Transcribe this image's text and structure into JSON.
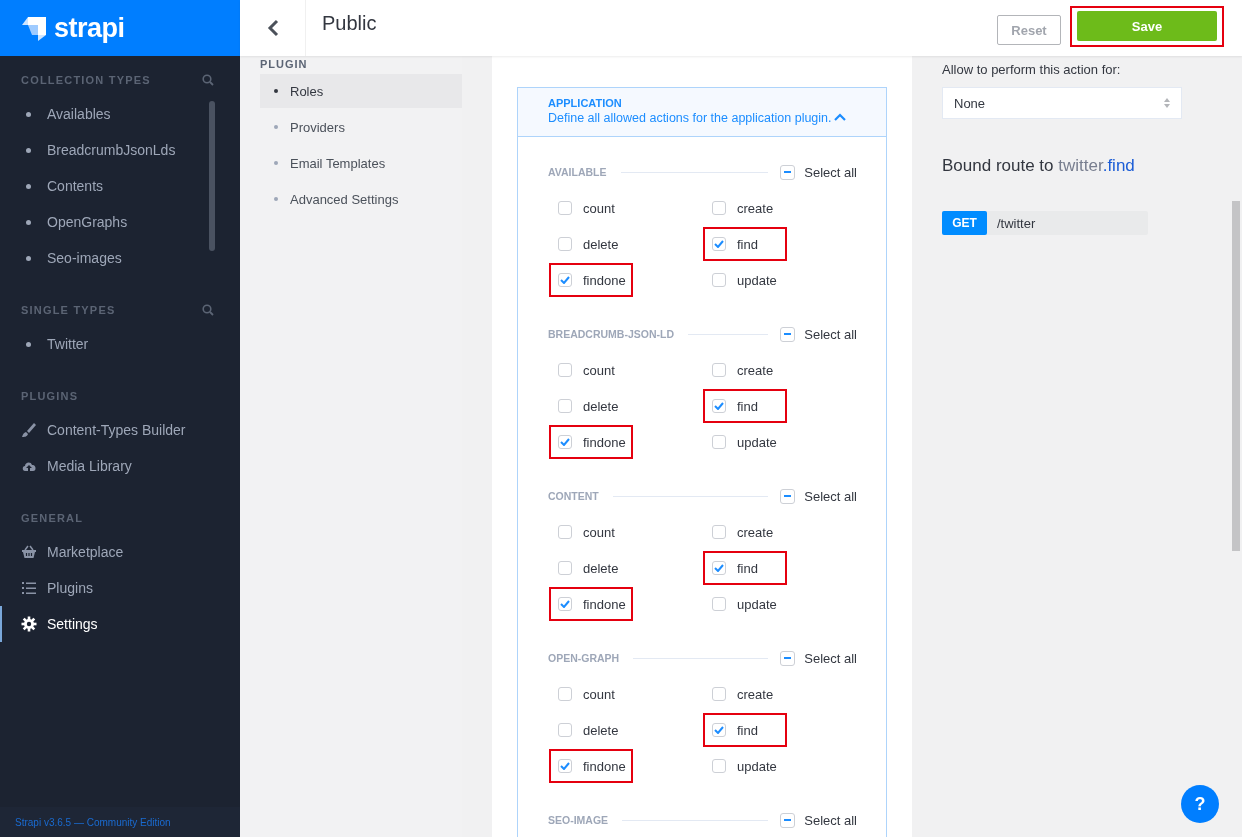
{
  "sidebar": {
    "logo": "strapi",
    "sections": [
      {
        "title": "COLLECTION TYPES",
        "searchable": true,
        "scrollable": true,
        "items": [
          {
            "label": "Availables",
            "kind": "bullet",
            "selected": false
          },
          {
            "label": "BreadcrumbJsonLds",
            "kind": "bullet",
            "selected": false
          },
          {
            "label": "Contents",
            "kind": "bullet",
            "selected": false
          },
          {
            "label": "OpenGraphs",
            "kind": "bullet",
            "selected": false
          },
          {
            "label": "Seo-images",
            "kind": "bullet",
            "selected": false
          }
        ]
      },
      {
        "title": "SINGLE TYPES",
        "searchable": true,
        "scrollable": false,
        "items": [
          {
            "label": "Twitter",
            "kind": "bullet",
            "selected": false
          }
        ]
      },
      {
        "title": "PLUGINS",
        "searchable": false,
        "scrollable": false,
        "items": [
          {
            "label": "Content-Types Builder",
            "kind": "brush",
            "selected": false
          },
          {
            "label": "Media Library",
            "kind": "cloud",
            "selected": false
          }
        ]
      },
      {
        "title": "GENERAL",
        "searchable": false,
        "scrollable": false,
        "items": [
          {
            "label": "Marketplace",
            "kind": "basket",
            "selected": false
          },
          {
            "label": "Plugins",
            "kind": "list",
            "selected": false
          },
          {
            "label": "Settings",
            "kind": "gear",
            "selected": true
          }
        ]
      }
    ],
    "footer": "Strapi v3.6.5 — Community Edition"
  },
  "header": {
    "title": "Public",
    "buttons": [
      {
        "label": "Reset",
        "kind": "secondary",
        "highlighted": false
      },
      {
        "label": "Save",
        "kind": "primary",
        "highlighted": true
      }
    ]
  },
  "subnav": {
    "title": "PLUGIN",
    "items": [
      {
        "label": "Roles",
        "selected": true
      },
      {
        "label": "Providers",
        "selected": false
      },
      {
        "label": "Email Templates",
        "selected": false
      },
      {
        "label": "Advanced Settings",
        "selected": false
      }
    ]
  },
  "plugin": {
    "name": "APPLICATION",
    "description": "Define all allowed actions for the application plugin.",
    "expanded": true,
    "groups": [
      {
        "name": "AVAILABLE",
        "select_all": {
          "label": "Select all",
          "indeterminate": true
        },
        "options": [
          {
            "label": "count",
            "checked": false,
            "highlighted": false
          },
          {
            "label": "create",
            "checked": false,
            "highlighted": false
          },
          {
            "label": "delete",
            "checked": false,
            "highlighted": false
          },
          {
            "label": "find",
            "checked": true,
            "highlighted": true
          },
          {
            "label": "findone",
            "checked": true,
            "highlighted": true
          },
          {
            "label": "update",
            "checked": false,
            "highlighted": false
          }
        ]
      },
      {
        "name": "BREADCRUMB-JSON-LD",
        "select_all": {
          "label": "Select all",
          "indeterminate": true
        },
        "options": [
          {
            "label": "count",
            "checked": false,
            "highlighted": false
          },
          {
            "label": "create",
            "checked": false,
            "highlighted": false
          },
          {
            "label": "delete",
            "checked": false,
            "highlighted": false
          },
          {
            "label": "find",
            "checked": true,
            "highlighted": true
          },
          {
            "label": "findone",
            "checked": true,
            "highlighted": true
          },
          {
            "label": "update",
            "checked": false,
            "highlighted": false
          }
        ]
      },
      {
        "name": "CONTENT",
        "select_all": {
          "label": "Select all",
          "indeterminate": true
        },
        "options": [
          {
            "label": "count",
            "checked": false,
            "highlighted": false
          },
          {
            "label": "create",
            "checked": false,
            "highlighted": false
          },
          {
            "label": "delete",
            "checked": false,
            "highlighted": false
          },
          {
            "label": "find",
            "checked": true,
            "highlighted": true
          },
          {
            "label": "findone",
            "checked": true,
            "highlighted": true
          },
          {
            "label": "update",
            "checked": false,
            "highlighted": false
          }
        ]
      },
      {
        "name": "OPEN-GRAPH",
        "select_all": {
          "label": "Select all",
          "indeterminate": true
        },
        "options": [
          {
            "label": "count",
            "checked": false,
            "highlighted": false
          },
          {
            "label": "create",
            "checked": false,
            "highlighted": false
          },
          {
            "label": "delete",
            "checked": false,
            "highlighted": false
          },
          {
            "label": "find",
            "checked": true,
            "highlighted": true
          },
          {
            "label": "findone",
            "checked": true,
            "highlighted": true
          },
          {
            "label": "update",
            "checked": false,
            "highlighted": false
          }
        ]
      },
      {
        "name": "SEO-IMAGE",
        "select_all": {
          "label": "Select all",
          "indeterminate": true
        }
      }
    ]
  },
  "details": {
    "policy_label": "Allow to perform this action for:",
    "policy_value": "None",
    "route_heading": "Bound route to",
    "route_controller": "twitter",
    "route_action": ".find",
    "route": {
      "method": "GET",
      "path": "/twitter"
    }
  },
  "help": "?"
}
